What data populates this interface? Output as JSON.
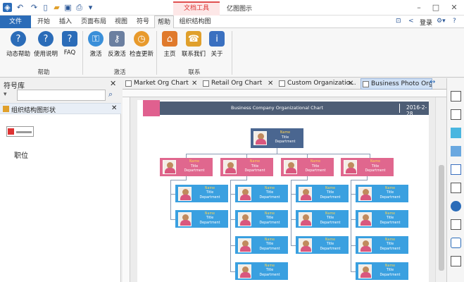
{
  "titlebar": {
    "context_tab": "文档工具",
    "app_title": "亿图图示",
    "quick_icons": [
      "app-icon",
      "undo-icon",
      "redo-icon",
      "new-file-icon",
      "open-folder-icon",
      "save-icon",
      "print-icon",
      "customize-icon"
    ]
  },
  "ribbon_tabs": {
    "file": "文件",
    "tabs": [
      "开始",
      "插入",
      "页面布局",
      "视图",
      "符号",
      "帮助",
      "组织结构图"
    ],
    "login": "登录"
  },
  "ribbon": {
    "groups": [
      {
        "name": "帮助",
        "buttons": [
          "动态帮助",
          "使用说明",
          "FAQ"
        ]
      },
      {
        "name": "激活",
        "buttons": [
          "激活",
          "反激活",
          "检查更新"
        ]
      },
      {
        "name": "联系",
        "buttons": [
          "主页",
          "联系我们",
          "关于"
        ]
      }
    ],
    "colors": {
      "help": "#2b6cb8",
      "activate": "#3a8fd9",
      "update": "#e89a2c",
      "home": "#e07a2c",
      "contact": "#e0a02c",
      "about": "#3a70c0"
    }
  },
  "library": {
    "title": "符号库",
    "search_placeholder": "",
    "category": "组织结构图形状",
    "shape_label": "职位"
  },
  "doc_tabs": [
    "Market Org Chart",
    "Retail Org Chart",
    "Custom Organizatio...",
    "Business Photo Org..."
  ],
  "chart": {
    "banner_title": "Business Company Organizational Chart",
    "banner_date": "2016-2-28",
    "box_name": "Name",
    "box_title": "Title",
    "box_department": "Department"
  }
}
